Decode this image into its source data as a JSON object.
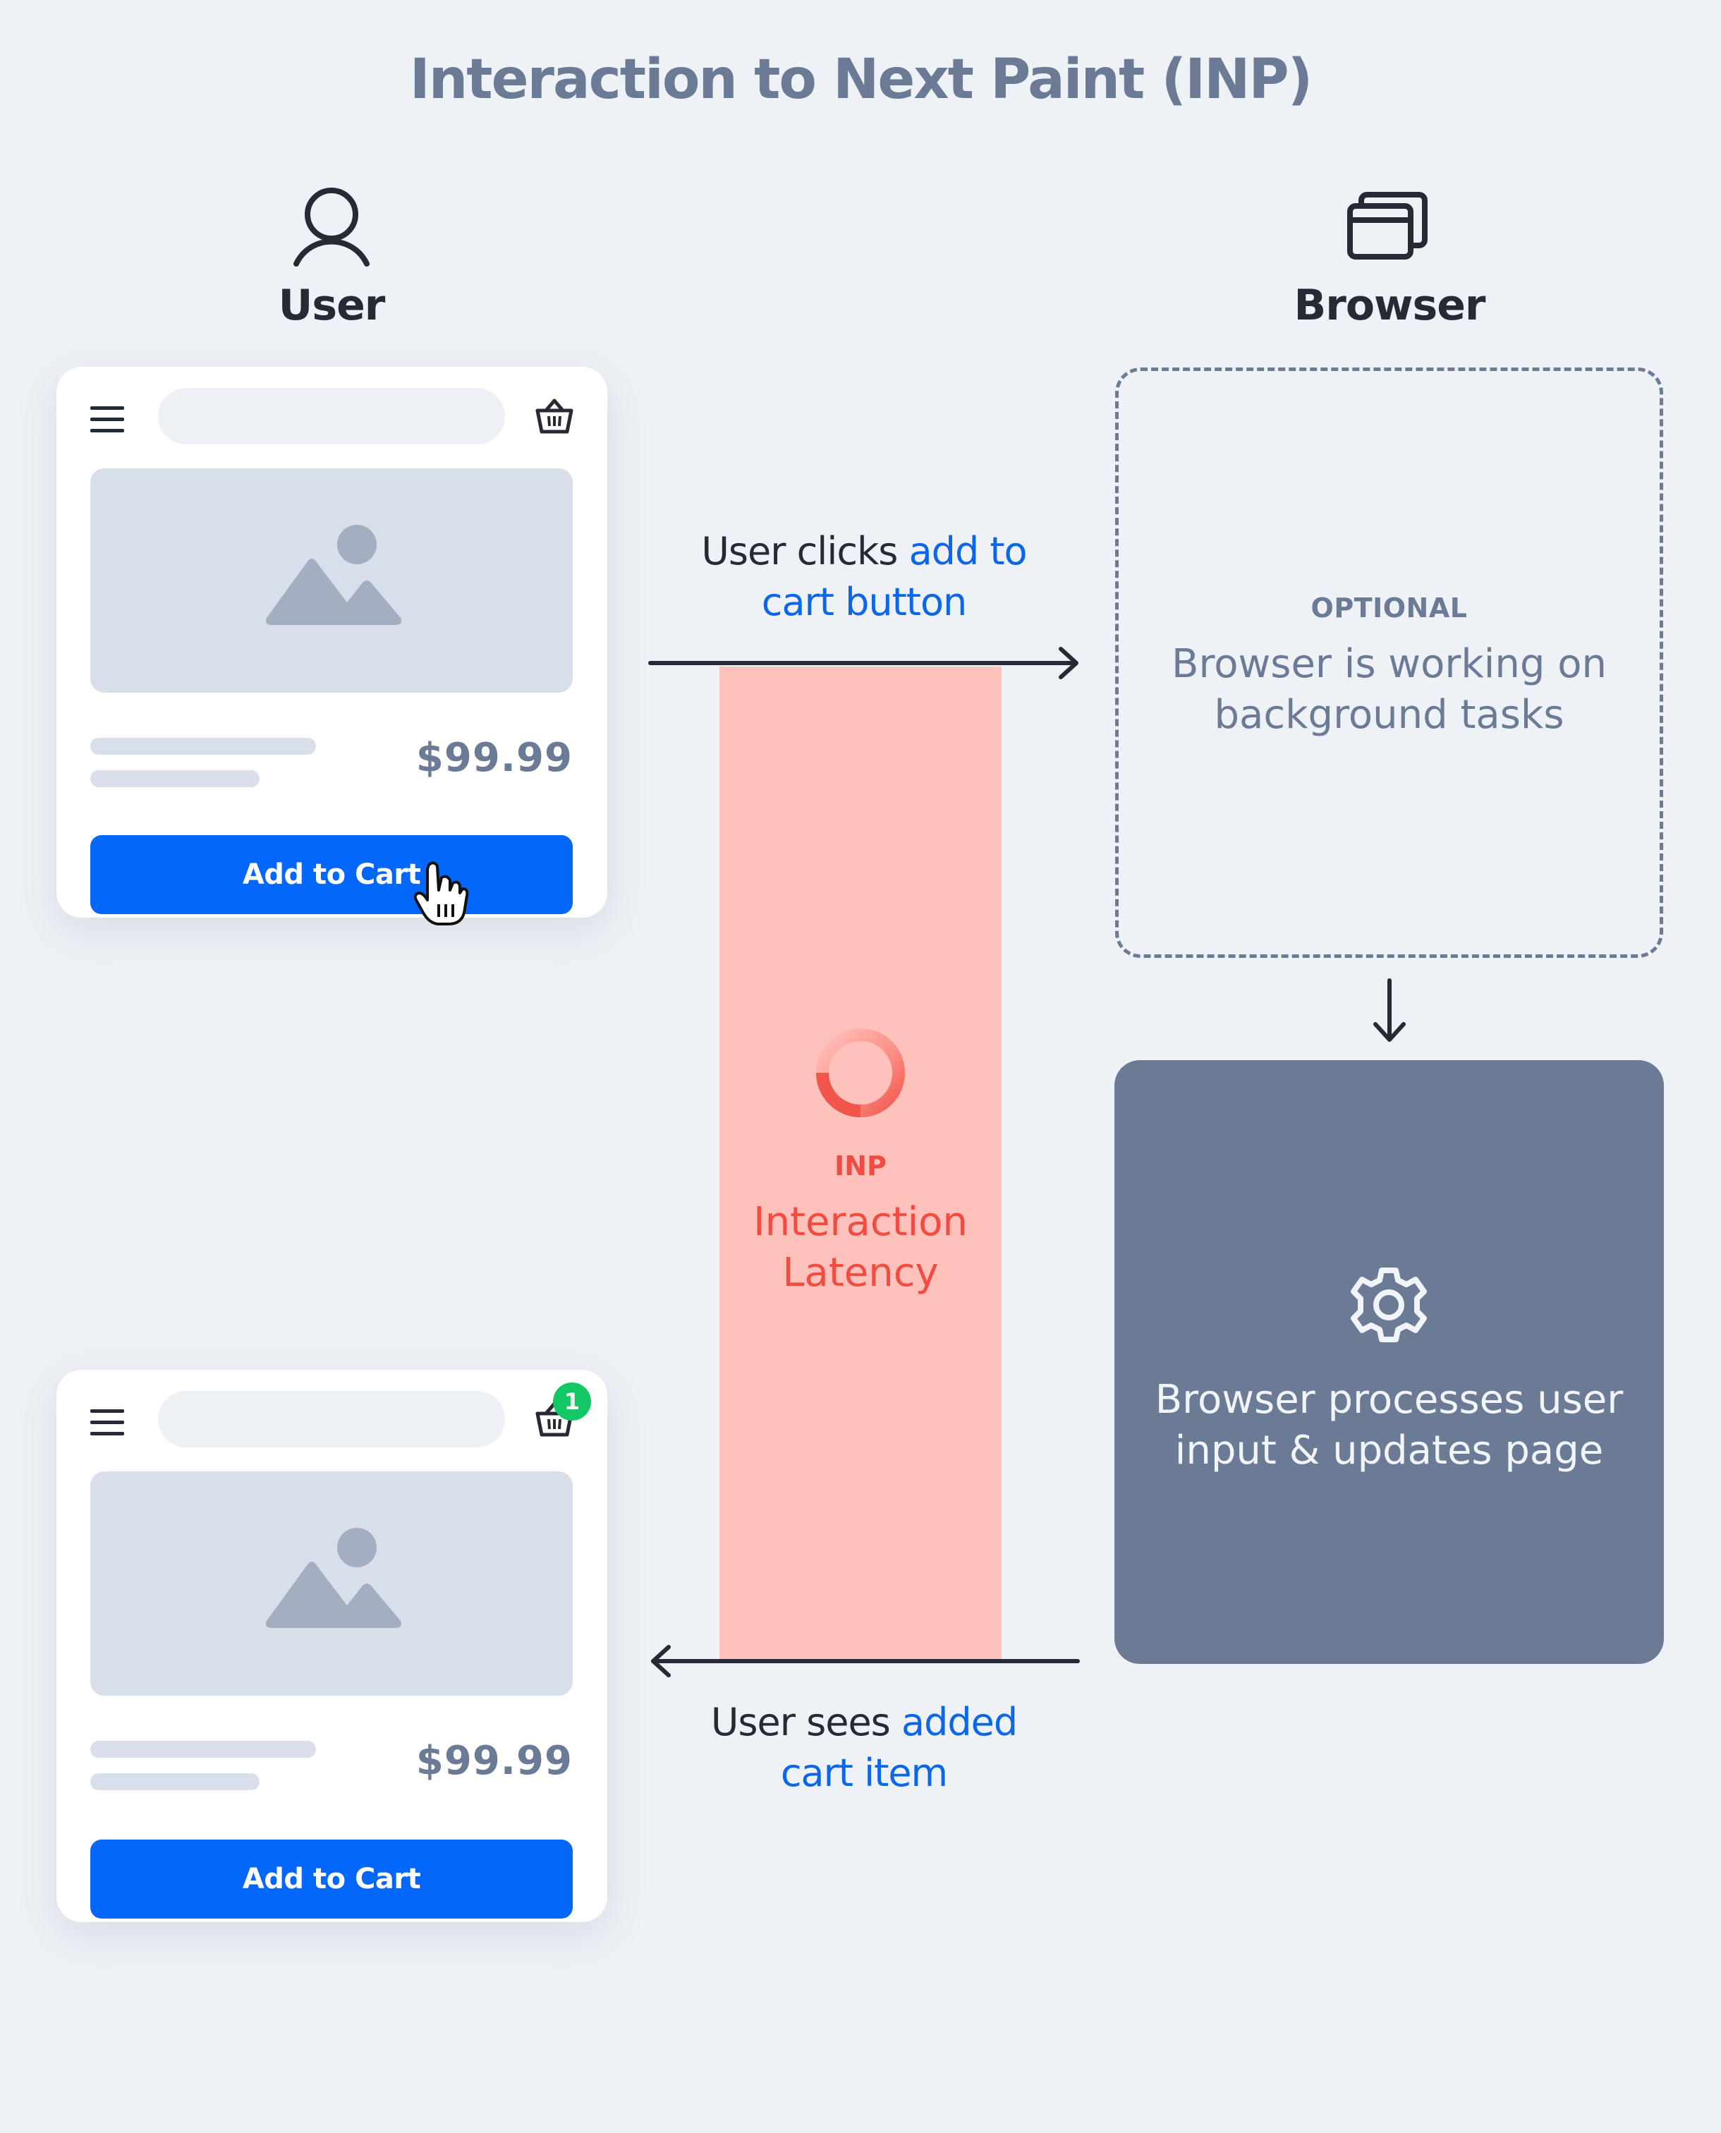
{
  "title": "Interaction to Next Paint (INP)",
  "actors": {
    "user": {
      "label": "User",
      "icon": "user-icon"
    },
    "browser": {
      "label": "Browser",
      "icon": "browser-windows-icon"
    }
  },
  "cards": [
    {
      "state": "before-click",
      "price": "$99.99",
      "button_label": "Add to Cart",
      "cart_badge": null,
      "cursor": "hand-pointer-icon"
    },
    {
      "state": "after-update",
      "price": "$99.99",
      "button_label": "Add to Cart",
      "cart_badge": "1"
    }
  ],
  "steps": {
    "click": {
      "prefix": "User clicks ",
      "highlight_line1": "add to",
      "highlight_line2": "cart button"
    },
    "sees": {
      "prefix": "User sees ",
      "highlight_line1": "added",
      "highlight_line2": "cart item"
    }
  },
  "latency": {
    "tag": "INP",
    "line1": "Interaction",
    "line2": "Latency"
  },
  "optional_box": {
    "tag": "OPTIONAL",
    "line1": "Browser is working on",
    "line2": "background tasks"
  },
  "process_box": {
    "icon": "gear-icon",
    "line1": "Browser processes user",
    "line2": "input & updates page"
  },
  "colors": {
    "background": "#eef1f6",
    "title": "#6b7b95",
    "accent_blue": "#0367fb",
    "highlight_text": "#0b67e8",
    "latency_fill": "#fec1bb",
    "latency_text": "#f24c40",
    "process_fill": "#6b7b95",
    "badge_green": "#13c764",
    "dark_text": "#262a35"
  }
}
